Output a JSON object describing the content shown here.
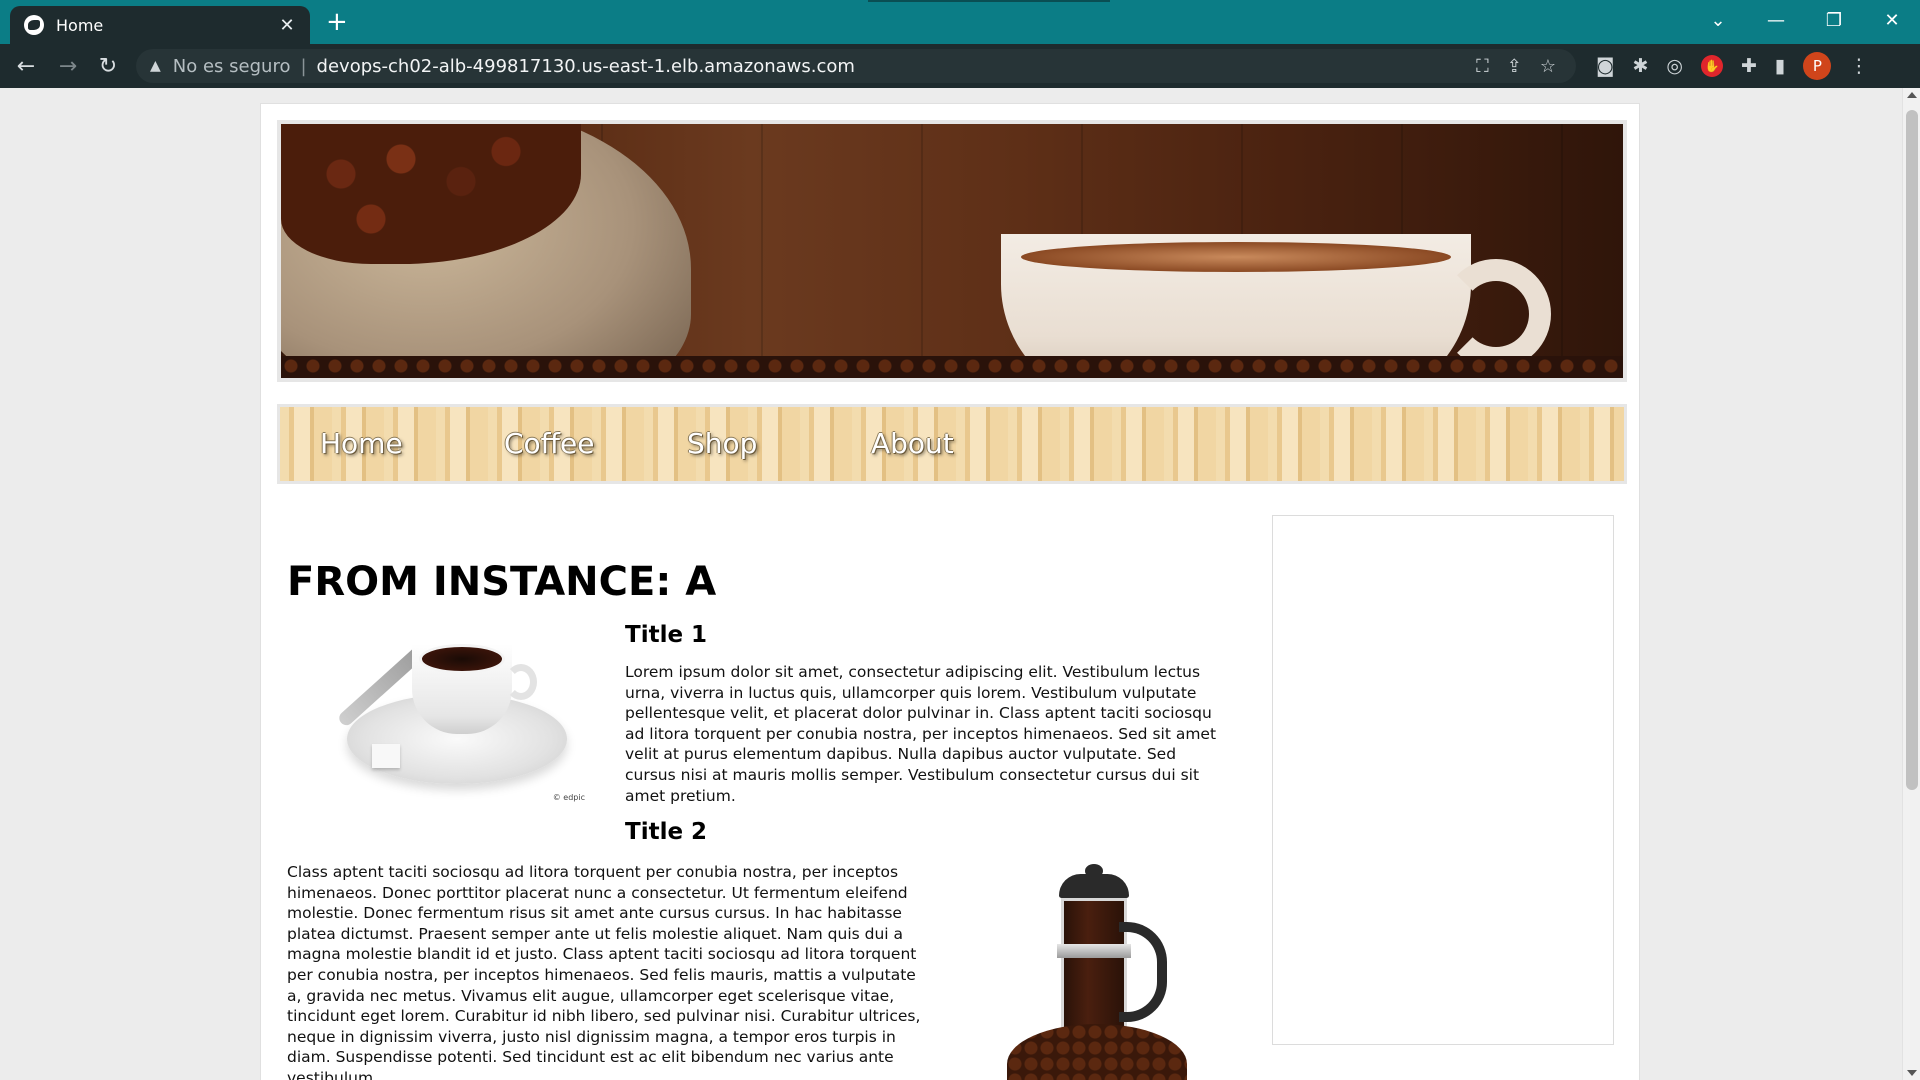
{
  "browser": {
    "tab": {
      "title": "Home"
    },
    "window_controls": {
      "minimize": "—",
      "restore": "❐",
      "close": "✕"
    },
    "address_bar": {
      "security_label": "No es seguro",
      "url": "devops-ch02-alb-499817130.us-east-1.elb.amazonaws.com"
    },
    "profile_initial": "P"
  },
  "site": {
    "nav": {
      "items": [
        {
          "label": "Home"
        },
        {
          "label": "Coffee"
        },
        {
          "label": "Shop"
        },
        {
          "label": "About"
        }
      ]
    },
    "main": {
      "page_title": "FROM INSTANCE: A",
      "image_credit": "© edpic",
      "sections": [
        {
          "title": "Title 1",
          "body": "Lorem ipsum dolor sit amet, consectetur adipiscing elit. Vestibulum lectus urna, viverra in luctus quis, ullamcorper quis lorem. Vestibulum vulputate pellentesque velit, et placerat dolor pulvinar in. Class aptent taciti sociosqu ad litora torquent per conubia nostra, per inceptos himenaeos. Sed sit amet velit at purus elementum dapibus. Nulla dapibus auctor vulputate. Sed cursus nisi at mauris mollis semper. Vestibulum consectetur cursus dui sit amet pretium."
        },
        {
          "title": "Title 2",
          "body": "Class aptent taciti sociosqu ad litora torquent per conubia nostra, per inceptos himenaeos. Donec porttitor placerat nunc a consectetur. Ut fermentum eleifend molestie. Donec fermentum risus sit amet ante cursus cursus. In hac habitasse platea dictumst. Praesent semper ante ut felis molestie aliquet. Nam quis dui a magna molestie blandit id et justo. Class aptent taciti sociosqu ad litora torquent per conubia nostra, per inceptos himenaeos. Sed felis mauris, mattis a vulputate a, gravida nec metus. Vivamus elit augue, ullamcorper eget scelerisque vitae, tincidunt eget lorem. Curabitur id nibh libero, sed pulvinar nisi. Curabitur ultrices, neque in dignissim viverra, justo nisl dignissim magna, a tempor eros turpis in diam. Suspendisse potenti. Sed tincidunt est ac elit bibendum nec varius ante vestibulum."
        }
      ]
    }
  },
  "colors": {
    "tab_strip": "#0b7d86",
    "toolbar": "#1e2b2e",
    "page_background": "#ececec"
  }
}
